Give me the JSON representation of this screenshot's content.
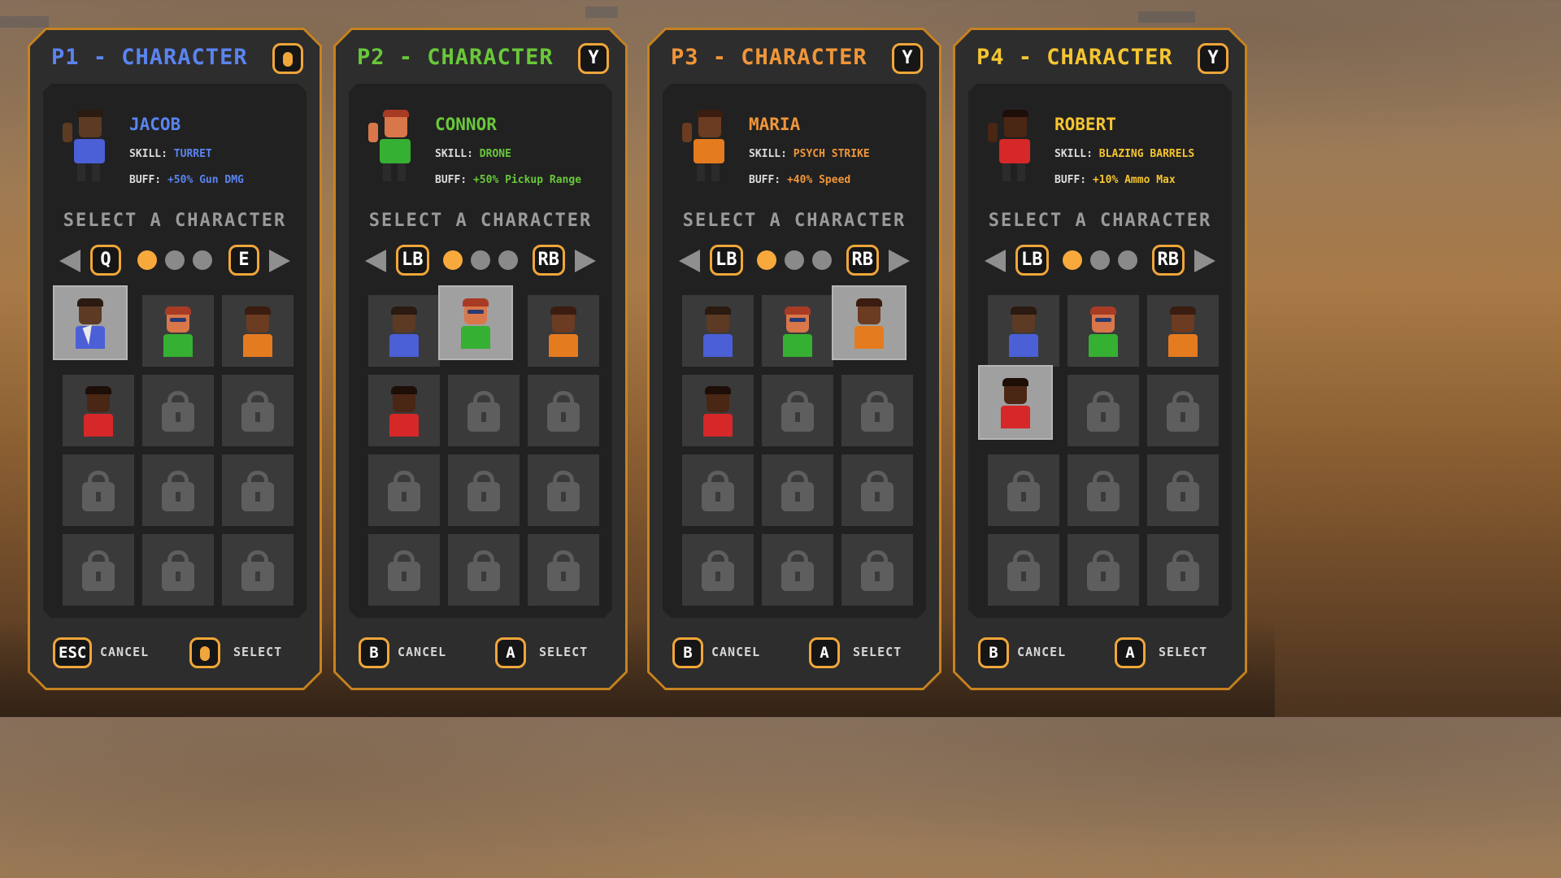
{
  "colors": {
    "accent": "#f0a63a",
    "border": "#c7821f",
    "p1": "#5a84f0",
    "p2": "#69c83a",
    "p3": "#f0963a",
    "p4": "#f5c531",
    "locked": "#5e5e5e"
  },
  "roster": [
    {
      "name": "jacob",
      "shirt": "#4b5fd6",
      "skin": "#5d3a24",
      "hair": "#2a1a10",
      "accent": "#5d3a24"
    },
    {
      "name": "connor",
      "shirt": "#35b032",
      "skin": "#d9774a",
      "hair": "#a83b24",
      "accent": "#2a3a70"
    },
    {
      "name": "maria",
      "shirt": "#e57b1f",
      "skin": "#6b3b22",
      "hair": "#3a1d10",
      "accent": "#6b3b22"
    },
    {
      "name": "robert",
      "shirt": "#d62828",
      "skin": "#4a2614",
      "hair": "#1d0e07",
      "accent": "#4a2614"
    }
  ],
  "panels": [
    {
      "title": "P1 - CHARACTER",
      "title_key": "mouse",
      "title_color": "#5a84f0",
      "character": {
        "name": "JACOB",
        "skill_label": "SKILL:",
        "skill": "TURRET",
        "buff_label": "BUFF:",
        "buff": "+50% Gun DMG"
      },
      "select_heading": "SELECT A CHARACTER",
      "prev_key": "Q",
      "next_key": "E",
      "page_dots": 3,
      "active_dot": 0,
      "selected_slot": 0,
      "cursor_visible": true,
      "footer": {
        "cancel_key": "ESC",
        "cancel_label": "CANCEL",
        "select_key": "mouse",
        "select_label": "SELECT"
      }
    },
    {
      "title": "P2 - CHARACTER",
      "title_key": "Y",
      "title_color": "#69c83a",
      "character": {
        "name": "CONNOR",
        "skill_label": "SKILL:",
        "skill": "DRONE",
        "buff_label": "BUFF:",
        "buff": "+50% Pickup Range"
      },
      "select_heading": "SELECT A CHARACTER",
      "prev_key": "LB",
      "next_key": "RB",
      "page_dots": 3,
      "active_dot": 0,
      "selected_slot": 1,
      "cursor_visible": false,
      "footer": {
        "cancel_key": "B",
        "cancel_label": "CANCEL",
        "select_key": "A",
        "select_label": "SELECT"
      }
    },
    {
      "title": "P3 - CHARACTER",
      "title_key": "Y",
      "title_color": "#f0963a",
      "character": {
        "name": "MARIA",
        "skill_label": "SKILL:",
        "skill": "PSYCH STRIKE",
        "buff_label": "BUFF:",
        "buff": "+40% Speed"
      },
      "select_heading": "SELECT A CHARACTER",
      "prev_key": "LB",
      "next_key": "RB",
      "page_dots": 3,
      "active_dot": 0,
      "selected_slot": 2,
      "cursor_visible": false,
      "footer": {
        "cancel_key": "B",
        "cancel_label": "CANCEL",
        "select_key": "A",
        "select_label": "SELECT"
      }
    },
    {
      "title": "P4 - CHARACTER",
      "title_key": "Y",
      "title_color": "#f5c531",
      "character": {
        "name": "ROBERT",
        "skill_label": "SKILL:",
        "skill": "BLAZING BARRELS",
        "buff_label": "BUFF:",
        "buff": "+10% Ammo Max"
      },
      "select_heading": "SELECT A CHARACTER",
      "prev_key": "LB",
      "next_key": "RB",
      "page_dots": 3,
      "active_dot": 0,
      "selected_slot": 3,
      "cursor_visible": false,
      "footer": {
        "cancel_key": "B",
        "cancel_label": "CANCEL",
        "select_key": "A",
        "select_label": "SELECT"
      }
    }
  ],
  "grid": {
    "columns": 3,
    "slots": [
      "jacob",
      "connor",
      "maria",
      "robert",
      "locked",
      "locked",
      "locked",
      "locked",
      "locked",
      "locked",
      "locked",
      "locked"
    ]
  }
}
